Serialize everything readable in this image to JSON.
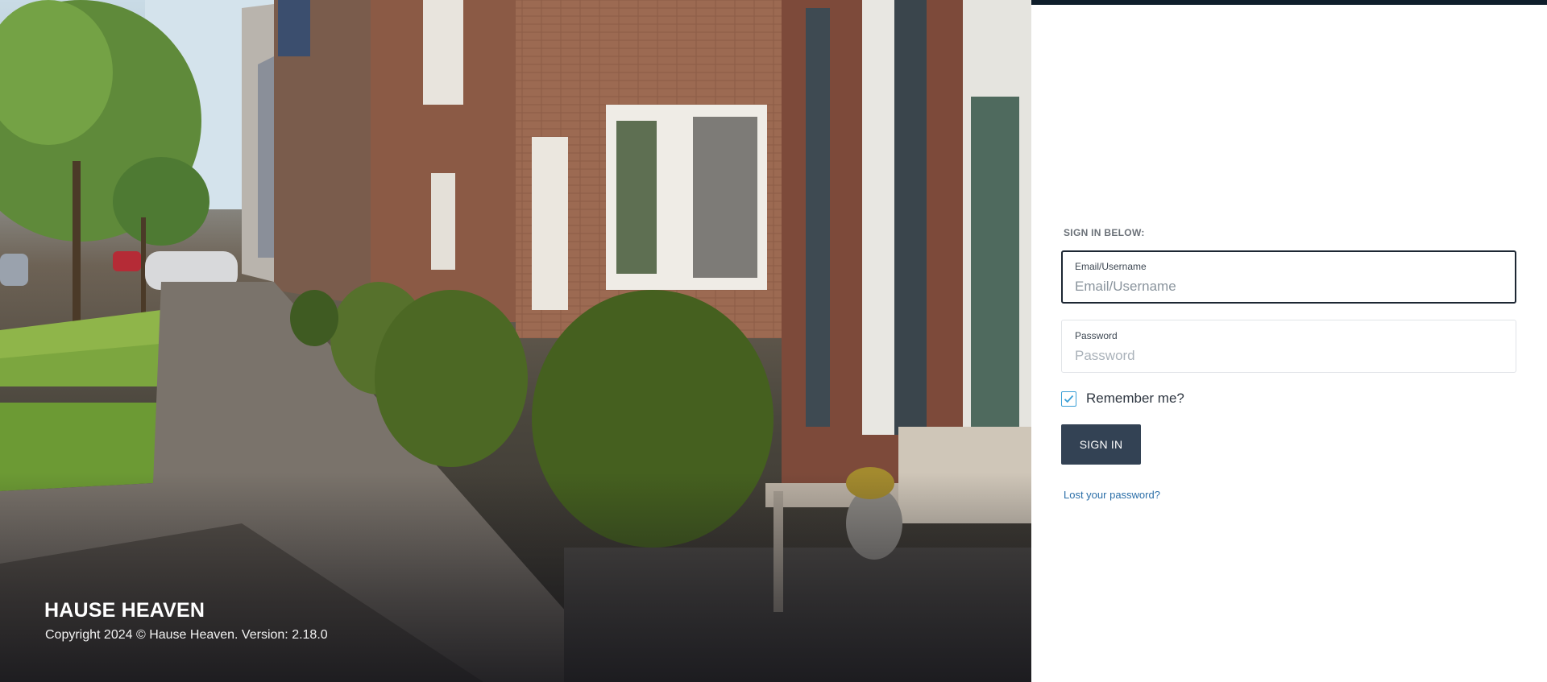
{
  "hero": {
    "brand": "HAUSE HEAVEN",
    "copyright": "Copyright 2024 © Hause Heaven. Version: 2.18.0",
    "image_icon": "residential-street-photo"
  },
  "signin": {
    "heading": "SIGN IN BELOW:",
    "username": {
      "label": "Email/Username",
      "placeholder": "Email/Username",
      "value": ""
    },
    "password": {
      "label": "Password",
      "placeholder": "Password",
      "value": ""
    },
    "remember": {
      "label": "Remember me?",
      "checked": true
    },
    "submit_label": "SIGN IN",
    "lost_password_label": "Lost your password?"
  },
  "colors": {
    "topbar": "#0f1e2b",
    "button": "#334254",
    "link": "#2c6fa8",
    "checkbox_accent": "#3a9fd6",
    "active_border": "#1d2733"
  }
}
